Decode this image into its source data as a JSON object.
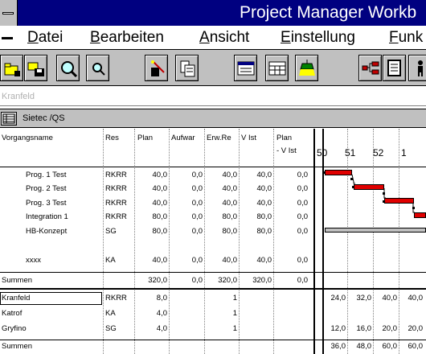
{
  "window": {
    "title": "Project Manager Workb"
  },
  "menu": {
    "items": [
      {
        "label": "Datei",
        "ul": "D",
        "rest": "atei"
      },
      {
        "label": "Bearbeiten",
        "ul": "B",
        "rest": "earbeiten"
      },
      {
        "label": "Ansicht",
        "ul": "A",
        "rest": "nsicht"
      },
      {
        "label": "Einstellung",
        "ul": "E",
        "rest": "instellung"
      },
      {
        "label": "Funk",
        "ul": "F",
        "rest": "unk"
      }
    ]
  },
  "toolbar": {
    "buttons": [
      "open-folder-icon",
      "save-file-icon",
      "zoom-in-icon",
      "zoom-out-icon",
      "magic-wand-icon",
      "calculator-icon",
      "window-icon",
      "calendar-icon",
      "lamp-icon",
      "network-icon",
      "document-icon",
      "person-icon"
    ]
  },
  "entry": {
    "value": "Kranfeld"
  },
  "filter": {
    "label": "Sietec /QS"
  },
  "table": {
    "headers": {
      "name": "Vorgangsname",
      "res": "Res",
      "plan": "Plan",
      "aufwand": "Aufwar",
      "erw": "Erw.Re",
      "vist": "V Ist",
      "planvist_1": "Plan",
      "planvist_2": "- V Ist"
    },
    "weeks": [
      "50",
      "51",
      "52",
      "1"
    ],
    "rows": [
      {
        "name": "Prog. 1 Test",
        "res": "RKRR",
        "plan": "40,0",
        "aufwand": "0,0",
        "erw": "40,0",
        "vist": "40,0",
        "planvist": "0,0"
      },
      {
        "name": "Prog. 2 Test",
        "res": "RKRR",
        "plan": "40,0",
        "aufwand": "0,0",
        "erw": "40,0",
        "vist": "40,0",
        "planvist": "0,0"
      },
      {
        "name": "Prog. 3 Test",
        "res": "RKRR",
        "plan": "40,0",
        "aufwand": "0,0",
        "erw": "40,0",
        "vist": "40,0",
        "planvist": "0,0"
      },
      {
        "name": "Integration 1",
        "res": "RKRR",
        "plan": "80,0",
        "aufwand": "0,0",
        "erw": "80,0",
        "vist": "80,0",
        "planvist": "0,0"
      },
      {
        "name": "HB-Konzept",
        "res": "SG",
        "plan": "80,0",
        "aufwand": "0,0",
        "erw": "80,0",
        "vist": "80,0",
        "planvist": "0,0"
      },
      {
        "name": "xxxx",
        "res": "KA",
        "plan": "40,0",
        "aufwand": "0,0",
        "erw": "40,0",
        "vist": "40,0",
        "planvist": "0,0"
      }
    ],
    "summary": {
      "label": "Summen",
      "plan": "320,0",
      "aufwand": "0,0",
      "erw": "320,0",
      "vist": "320,0",
      "planvist": "0,0"
    }
  },
  "resources": {
    "rows": [
      {
        "name": "Kranfeld",
        "res": "RKRR",
        "plan": "8,0",
        "count": "1",
        "w50": "24,0",
        "w51": "32,0",
        "w52": "40,0",
        "w1": "40,0"
      },
      {
        "name": "Katrof",
        "res": "KA",
        "plan": "4,0",
        "count": "1",
        "w50": "",
        "w51": "",
        "w52": "",
        "w1": ""
      },
      {
        "name": "Gryfino",
        "res": "SG",
        "plan": "4,0",
        "count": "1",
        "w50": "12,0",
        "w51": "16,0",
        "w52": "20,0",
        "w1": "20,0"
      }
    ],
    "summary": {
      "label": "Summen",
      "w50": "36,0",
      "w51": "48,0",
      "w52": "60,0",
      "w1": "60,0"
    }
  },
  "colors": {
    "titlebar": "#000080",
    "bar": "#e00000",
    "face": "#c0c0c0"
  }
}
